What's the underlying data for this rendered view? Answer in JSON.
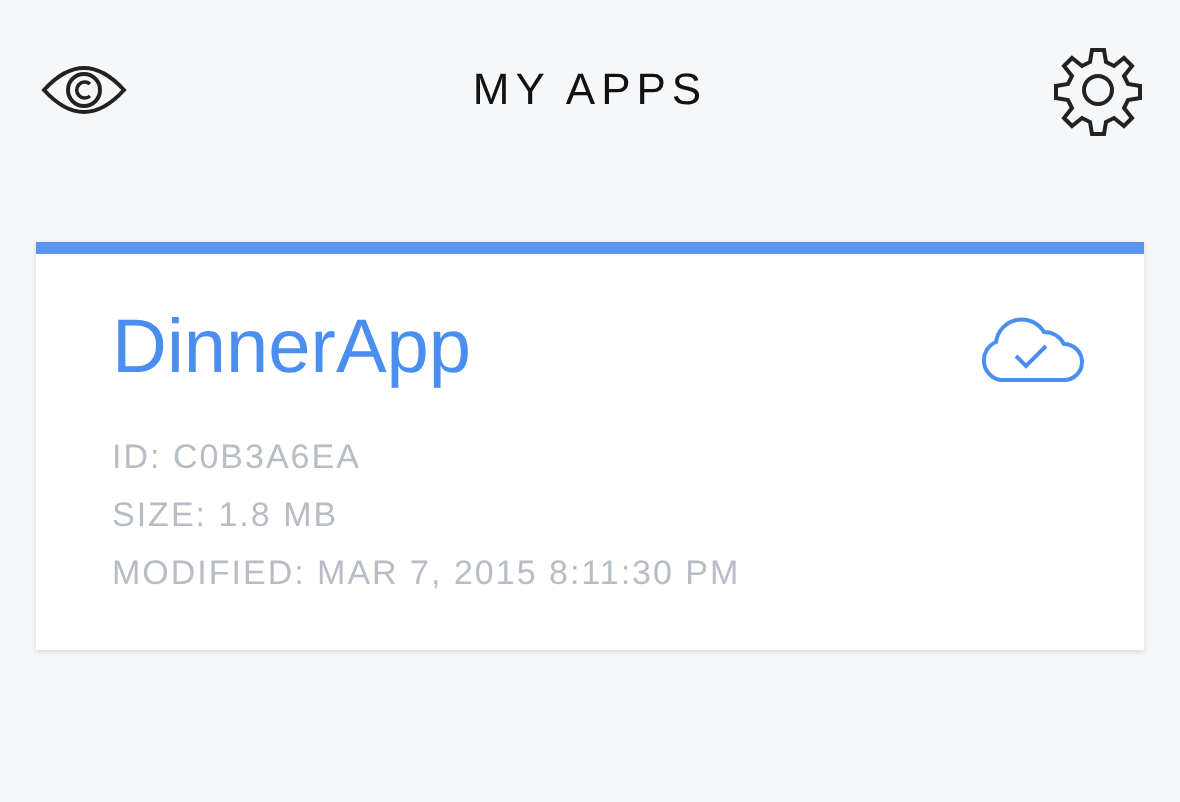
{
  "header": {
    "title": "MY APPS"
  },
  "apps": [
    {
      "name": "DinnerApp",
      "synced": true,
      "details": [
        "ID: C0B3A6EA",
        "SIZE: 1.8 MB",
        "MODIFIED: MAR 7, 2015 8:11:30 PM"
      ]
    }
  ]
}
